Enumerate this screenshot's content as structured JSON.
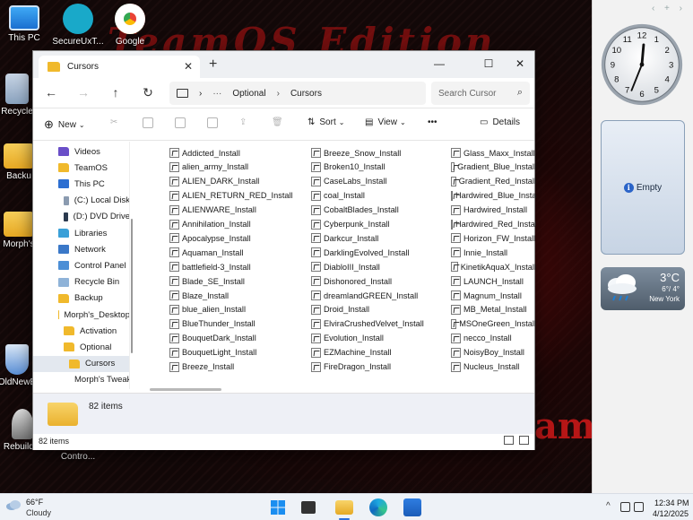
{
  "desktop": {
    "wallpaper_title": "TeamOS Edition",
    "wallpaper_word": "ams",
    "icons": [
      {
        "label": "This PC",
        "icon": "monitor-icon"
      },
      {
        "label": "SecureUxT...",
        "icon": "pen-icon"
      },
      {
        "label": "Google",
        "icon": "chrome-icon"
      },
      {
        "label": "Recycle",
        "icon": "recycle-bin-icon"
      },
      {
        "label": "Backu",
        "icon": "folder-icon"
      },
      {
        "label": "Morph's",
        "icon": "folder-icon"
      },
      {
        "label": "OldNewE",
        "icon": "shield-icon"
      },
      {
        "label": "Rebuild...",
        "icon": "wizard-icon"
      },
      {
        "label": "Contro...",
        "icon": "control-panel-icon"
      }
    ]
  },
  "gadgets": {
    "empty_label": "Empty",
    "weather": {
      "temp": "3°C",
      "range": "6°/ 4°",
      "city": "New York"
    },
    "clock_numbers": [
      "12",
      "1",
      "2",
      "3",
      "4",
      "5",
      "6",
      "7",
      "8",
      "9",
      "10",
      "11"
    ]
  },
  "window": {
    "tab_title": "Cursors",
    "controls": {
      "minimize": "—",
      "maximize": "☐",
      "close": "✕"
    },
    "breadcrumb": {
      "ellipsis": "···",
      "parent": "Optional",
      "current": "Cursors"
    },
    "search_placeholder": "Search Cursor",
    "toolbar": {
      "new": "New",
      "sort": "Sort",
      "view": "View",
      "more": "•••",
      "details": "Details"
    },
    "nav_items": [
      {
        "label": "Videos",
        "icon": "ni video",
        "indent": 28,
        "selected": false
      },
      {
        "label": "TeamOS",
        "icon": "ni folder",
        "indent": 28,
        "selected": false
      },
      {
        "label": "This PC",
        "icon": "ni pc",
        "indent": 28,
        "selected": false
      },
      {
        "label": "(C:) Local Disk",
        "icon": "ni disk",
        "indent": 34,
        "selected": false
      },
      {
        "label": "(D:) DVD Drive",
        "icon": "ni dvd",
        "indent": 34,
        "selected": false
      },
      {
        "label": "Libraries",
        "icon": "ni lib",
        "indent": 28,
        "selected": false
      },
      {
        "label": "Network",
        "icon": "ni net",
        "indent": 28,
        "selected": false
      },
      {
        "label": "Control Panel",
        "icon": "ni cpl",
        "indent": 28,
        "selected": false
      },
      {
        "label": "Recycle Bin",
        "icon": "ni bin",
        "indent": 28,
        "selected": false
      },
      {
        "label": "Backup",
        "icon": "ni folder",
        "indent": 28,
        "selected": false
      },
      {
        "label": "Morph's_Desktop",
        "icon": "ni folder",
        "indent": 28,
        "selected": false
      },
      {
        "label": "Activation",
        "icon": "ni folder",
        "indent": 34,
        "selected": false
      },
      {
        "label": "Optional",
        "icon": "ni folder",
        "indent": 34,
        "selected": false
      },
      {
        "label": "Cursors",
        "icon": "ni folder",
        "indent": 40,
        "selected": true
      },
      {
        "label": "Morph's Tweaks",
        "icon": "ni folder",
        "indent": 40,
        "selected": false
      }
    ],
    "files": [
      [
        "Addicted_Install",
        "alien_army_Install",
        "ALIEN_DARK_Install",
        "ALIEN_RETURN_RED_Install",
        "ALIENWARE_Install",
        "Annihilation_Install",
        "Apocalypse_Install",
        "Aquaman_Install",
        "battlefield-3_Install",
        "Blade_SE_Install",
        "Blaze_Install",
        "blue_alien_Install",
        "BlueThunder_Install",
        "BouquetDark_Install",
        "BouquetLight_Install",
        "Breeze_Install"
      ],
      [
        "Breeze_Snow_Install",
        "Broken10_Install",
        "CaseLabs_Install",
        "coal_Install",
        "CobaltBlades_Install",
        "Cyberpunk_Install",
        "Darkcur_Install",
        "DarklingEvolved_Install",
        "DiabloIII_Install",
        "Dishonored_Install",
        "dreamlandGREEN_Install",
        "Droid_Install",
        "ElviraCrushedVelvet_Install",
        "Evolution_Install",
        "EZMachine_Install",
        "FireDragon_Install"
      ],
      [
        "Glass_Maxx_Install",
        "Gradient_Blue_Install",
        "Gradient_Red_Install",
        "Hardwired_Blue_Install",
        "Hardwired_Install",
        "Hardwired_Red_Install",
        "Horizon_FW_Install",
        "Innie_Install",
        "KinetikAquaX_Install",
        "LAUNCH_Install",
        "Magnum_Install",
        "MB_Metal_Install",
        "MSOneGreen_Install",
        "necco_Install",
        "NoisyBoy_Install",
        "Nucleus_Install"
      ]
    ],
    "details_count": "82 items",
    "status_count": "82 items"
  },
  "taskbar": {
    "weather_temp": "66°F",
    "weather_cond": "Cloudy",
    "time": "12:34 PM",
    "date": "4/12/2025"
  }
}
